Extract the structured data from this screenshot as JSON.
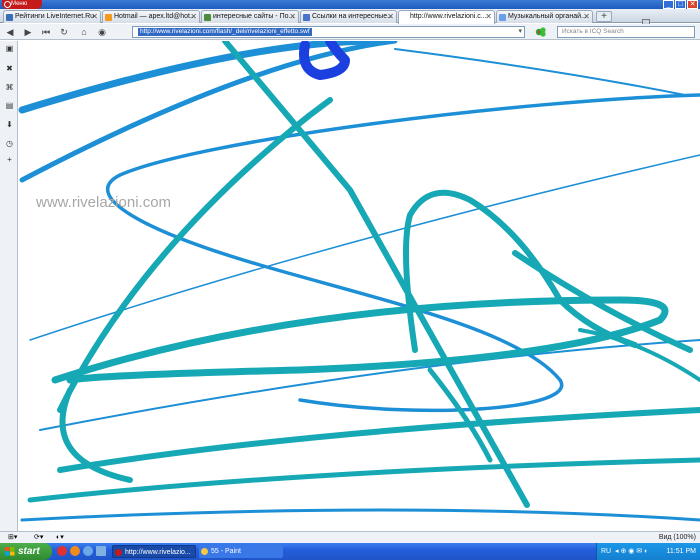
{
  "window": {
    "menu_label": "Меню"
  },
  "tabs": [
    {
      "title": "Рейтинги LiveInternet.Ru",
      "fav": "#3a6fb5",
      "active": false
    },
    {
      "title": "Hotmail — apex.ltd@hot...",
      "fav": "#f39a1f",
      "active": false
    },
    {
      "title": "интересные сайты - По...",
      "fav": "#4b8d3a",
      "active": false
    },
    {
      "title": "Ссылки на интересные...",
      "fav": "#4a74c9",
      "active": false
    },
    {
      "title": "http://www.rivelazioni.c...",
      "fav": "#ffffff",
      "active": true
    },
    {
      "title": "Музыкальный органай...",
      "fav": "#6aa0e8",
      "active": false
    }
  ],
  "address": {
    "url": "http://www.rivelazioni.com/flash/_deli/rivelazioni_effetto.swf",
    "search_placeholder": "Искать в ICQ Search"
  },
  "page": {
    "watermark": "www.rivelazioni.com"
  },
  "status": {
    "zoom": "Вид (100%)"
  },
  "taskbar": {
    "start_label": "start",
    "items": [
      {
        "label": "http://www.rivelazio...",
        "icon_color": "#c41a1a"
      },
      {
        "label": "55 - Paint",
        "icon_color": "#f5c842"
      }
    ],
    "lang": "RU",
    "clock": "11:51 PM"
  },
  "colors": {
    "stroke_teal": "#16a8b4",
    "stroke_blue": "#1c8fd6",
    "blob": "#1c3fe0"
  }
}
